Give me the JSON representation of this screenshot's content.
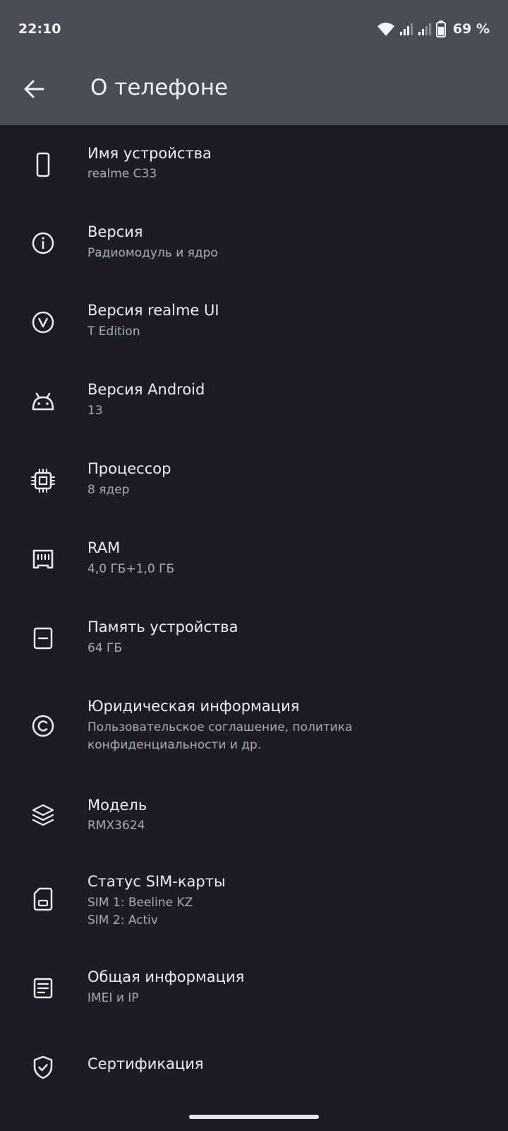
{
  "status_bar": {
    "time": "22:10",
    "battery_percent": "69 %",
    "icons": [
      "wifi-icon",
      "signal-sim1-icon",
      "signal-sim2-icon",
      "battery-icon"
    ]
  },
  "toolbar": {
    "title": "О телефоне",
    "back_icon": "arrow-left-icon"
  },
  "items": [
    {
      "icon": "phone-icon",
      "title": "Имя устройства",
      "subtitle": "realme C33"
    },
    {
      "icon": "info-icon",
      "title": "Версия",
      "subtitle": "Радиомодуль и ядро"
    },
    {
      "icon": "version-v-icon",
      "title": "Версия realme UI",
      "subtitle": "T Edition"
    },
    {
      "icon": "android-icon",
      "title": "Версия Android",
      "subtitle": "13"
    },
    {
      "icon": "processor-chip-icon",
      "title": "Процессор",
      "subtitle": "8 ядер"
    },
    {
      "icon": "ram-icon",
      "title": "RAM",
      "subtitle": "4,0 ГБ+1,0 ГБ"
    },
    {
      "icon": "storage-icon",
      "title": "Память устройства",
      "subtitle": "64 ГБ"
    },
    {
      "icon": "copyright-icon",
      "title": "Юридическая информация",
      "subtitle": "Пользовательское соглашение, политика конфиденциальности и др."
    },
    {
      "icon": "layers-icon",
      "title": "Модель",
      "subtitle": "RMX3624"
    },
    {
      "icon": "sim-card-icon",
      "title": "Статус SIM-карты",
      "subtitle_lines": [
        "SIM 1: Beeline KZ",
        "SIM 2: Activ"
      ]
    },
    {
      "icon": "document-icon",
      "title": "Общая информация",
      "subtitle": "IMEI и IP"
    },
    {
      "icon": "shield-check-icon",
      "title": "Сертификация",
      "subtitle": ""
    }
  ]
}
